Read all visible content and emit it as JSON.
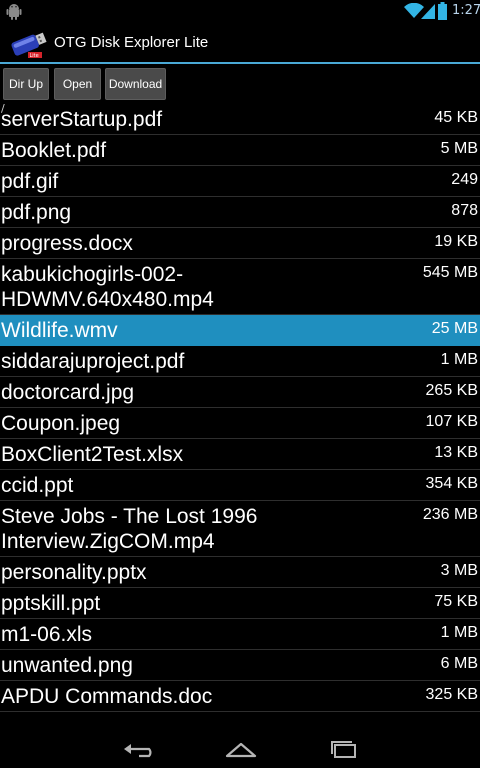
{
  "status_bar": {
    "time": "1:27"
  },
  "action_bar": {
    "title": "OTG Disk Explorer Lite"
  },
  "toolbar": {
    "dir_up": "Dir Up",
    "open": "Open",
    "download": "Download"
  },
  "path": "/",
  "files": [
    {
      "name": "serverStartup.pdf",
      "size": "45 KB"
    },
    {
      "name": "Booklet.pdf",
      "size": "5 MB"
    },
    {
      "name": "pdf.gif",
      "size": "249"
    },
    {
      "name": "pdf.png",
      "size": "878"
    },
    {
      "name": "progress.docx",
      "size": "19 KB"
    },
    {
      "name": "kabukichogirls-002-\nHDWMV.640x480.mp4",
      "size": "545 MB"
    },
    {
      "name": "Wildlife.wmv",
      "size": "25 MB",
      "selected": true
    },
    {
      "name": "siddarajuproject.pdf",
      "size": "1 MB"
    },
    {
      "name": "doctorcard.jpg",
      "size": "265 KB"
    },
    {
      "name": "Coupon.jpeg",
      "size": "107 KB"
    },
    {
      "name": "BoxClient2Test.xlsx",
      "size": "13 KB"
    },
    {
      "name": "ccid.ppt",
      "size": "354 KB"
    },
    {
      "name": "Steve Jobs - The Lost 1996\nInterview.ZigCOM.mp4",
      "size": "236 MB"
    },
    {
      "name": "personality.pptx",
      "size": "3 MB"
    },
    {
      "name": "pptskill.ppt",
      "size": "75 KB"
    },
    {
      "name": "m1-06.xls",
      "size": "1 MB"
    },
    {
      "name": "unwanted.png",
      "size": "6 MB"
    },
    {
      "name": "APDU Commands.doc",
      "size": "325 KB"
    }
  ],
  "colors": {
    "accent": "#4aa9d6",
    "selected": "#1f8fbf",
    "button": "#4a4a4a"
  }
}
